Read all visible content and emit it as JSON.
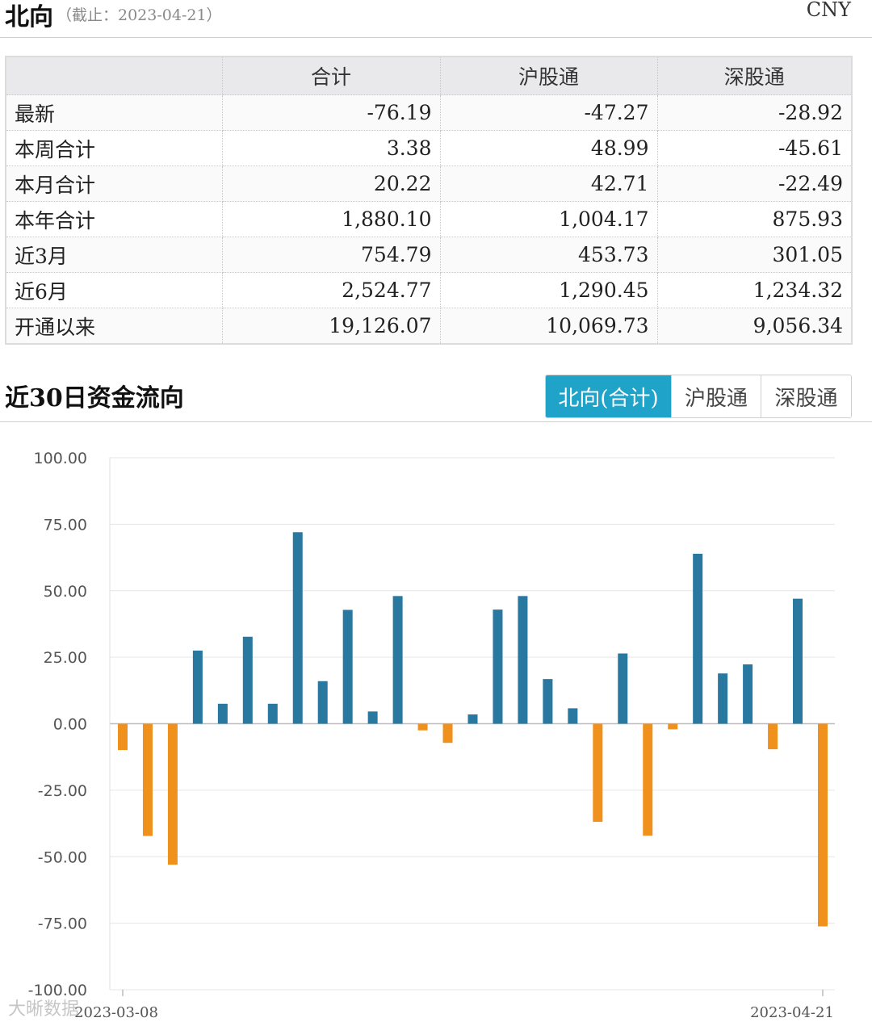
{
  "header": {
    "title": "北向",
    "as_of": "（截止：2023-04-21）",
    "currency": "CNY"
  },
  "table": {
    "columns": [
      "",
      "合计",
      "沪股通",
      "深股通"
    ],
    "rows": [
      {
        "label": "最新",
        "total": "-76.19",
        "sh": "-47.27",
        "sz": "-28.92"
      },
      {
        "label": "本周合计",
        "total": "3.38",
        "sh": "48.99",
        "sz": "-45.61"
      },
      {
        "label": "本月合计",
        "total": "20.22",
        "sh": "42.71",
        "sz": "-22.49"
      },
      {
        "label": "本年合计",
        "total": "1,880.10",
        "sh": "1,004.17",
        "sz": "875.93"
      },
      {
        "label": "近3月",
        "total": "754.79",
        "sh": "453.73",
        "sz": "301.05"
      },
      {
        "label": "近6月",
        "total": "2,524.77",
        "sh": "1,290.45",
        "sz": "1,234.32"
      },
      {
        "label": "开通以来",
        "total": "19,126.07",
        "sh": "10,069.73",
        "sz": "9,056.34"
      }
    ]
  },
  "section": {
    "title": "近30日资金流向",
    "tabs": [
      {
        "label": "北向(合计)",
        "active": true
      },
      {
        "label": "沪股通",
        "active": false
      },
      {
        "label": "深股通",
        "active": false
      }
    ]
  },
  "watermark": "大晰数据",
  "colors": {
    "positive": "#2878a0",
    "negative": "#f0911e",
    "active_tab": "#1fa3c8"
  },
  "chart_data": {
    "type": "bar",
    "x_start_label": "2023-03-08",
    "x_end_label": "2023-04-21",
    "values": [
      -9.9,
      -42.2,
      -53.0,
      27.5,
      7.5,
      32.7,
      7.5,
      72.0,
      16.0,
      42.8,
      4.6,
      48.0,
      -2.5,
      -7.2,
      3.5,
      42.9,
      48.0,
      16.8,
      5.8,
      -36.9,
      26.4,
      -42.1,
      -2.1,
      63.9,
      18.9,
      22.3,
      -9.6,
      47.0,
      -76.19
    ],
    "yticks": [
      "100.00",
      "75.00",
      "50.00",
      "25.00",
      "0.00",
      "-25.00",
      "-50.00",
      "-75.00",
      "-100.00"
    ],
    "ylim": [
      -100,
      100
    ],
    "grid": true
  }
}
